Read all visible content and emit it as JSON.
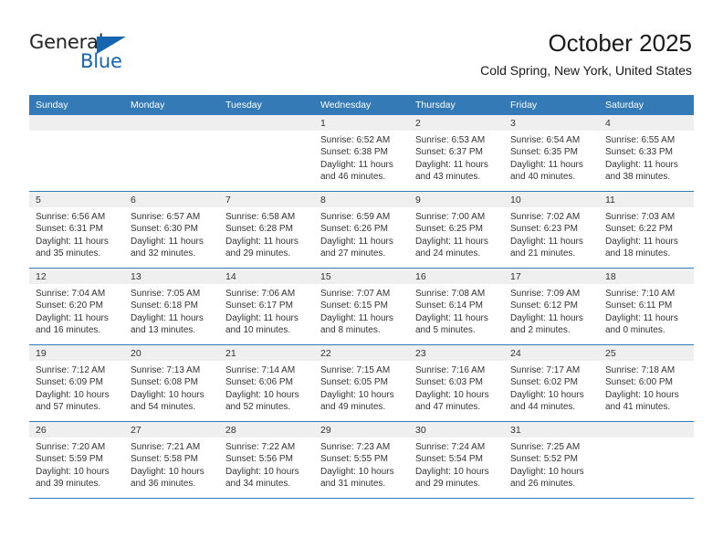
{
  "brand": {
    "name_part1": "General",
    "name_part2": "Blue",
    "accent_color": "#1565b0"
  },
  "header": {
    "title": "October 2025",
    "subtitle": "Cold Spring, New York, United States",
    "header_bg_color": "#337ab7",
    "daynum_band_color": "#efefef"
  },
  "weekday_headers": [
    "Sunday",
    "Monday",
    "Tuesday",
    "Wednesday",
    "Thursday",
    "Friday",
    "Saturday"
  ],
  "weeks": [
    [
      {
        "day": "",
        "sunrise": "",
        "sunset": "",
        "daylight_line1": "",
        "daylight_line2": ""
      },
      {
        "day": "",
        "sunrise": "",
        "sunset": "",
        "daylight_line1": "",
        "daylight_line2": ""
      },
      {
        "day": "",
        "sunrise": "",
        "sunset": "",
        "daylight_line1": "",
        "daylight_line2": ""
      },
      {
        "day": "1",
        "sunrise": "Sunrise: 6:52 AM",
        "sunset": "Sunset: 6:38 PM",
        "daylight_line1": "Daylight: 11 hours",
        "daylight_line2": "and 46 minutes."
      },
      {
        "day": "2",
        "sunrise": "Sunrise: 6:53 AM",
        "sunset": "Sunset: 6:37 PM",
        "daylight_line1": "Daylight: 11 hours",
        "daylight_line2": "and 43 minutes."
      },
      {
        "day": "3",
        "sunrise": "Sunrise: 6:54 AM",
        "sunset": "Sunset: 6:35 PM",
        "daylight_line1": "Daylight: 11 hours",
        "daylight_line2": "and 40 minutes."
      },
      {
        "day": "4",
        "sunrise": "Sunrise: 6:55 AM",
        "sunset": "Sunset: 6:33 PM",
        "daylight_line1": "Daylight: 11 hours",
        "daylight_line2": "and 38 minutes."
      }
    ],
    [
      {
        "day": "5",
        "sunrise": "Sunrise: 6:56 AM",
        "sunset": "Sunset: 6:31 PM",
        "daylight_line1": "Daylight: 11 hours",
        "daylight_line2": "and 35 minutes."
      },
      {
        "day": "6",
        "sunrise": "Sunrise: 6:57 AM",
        "sunset": "Sunset: 6:30 PM",
        "daylight_line1": "Daylight: 11 hours",
        "daylight_line2": "and 32 minutes."
      },
      {
        "day": "7",
        "sunrise": "Sunrise: 6:58 AM",
        "sunset": "Sunset: 6:28 PM",
        "daylight_line1": "Daylight: 11 hours",
        "daylight_line2": "and 29 minutes."
      },
      {
        "day": "8",
        "sunrise": "Sunrise: 6:59 AM",
        "sunset": "Sunset: 6:26 PM",
        "daylight_line1": "Daylight: 11 hours",
        "daylight_line2": "and 27 minutes."
      },
      {
        "day": "9",
        "sunrise": "Sunrise: 7:00 AM",
        "sunset": "Sunset: 6:25 PM",
        "daylight_line1": "Daylight: 11 hours",
        "daylight_line2": "and 24 minutes."
      },
      {
        "day": "10",
        "sunrise": "Sunrise: 7:02 AM",
        "sunset": "Sunset: 6:23 PM",
        "daylight_line1": "Daylight: 11 hours",
        "daylight_line2": "and 21 minutes."
      },
      {
        "day": "11",
        "sunrise": "Sunrise: 7:03 AM",
        "sunset": "Sunset: 6:22 PM",
        "daylight_line1": "Daylight: 11 hours",
        "daylight_line2": "and 18 minutes."
      }
    ],
    [
      {
        "day": "12",
        "sunrise": "Sunrise: 7:04 AM",
        "sunset": "Sunset: 6:20 PM",
        "daylight_line1": "Daylight: 11 hours",
        "daylight_line2": "and 16 minutes."
      },
      {
        "day": "13",
        "sunrise": "Sunrise: 7:05 AM",
        "sunset": "Sunset: 6:18 PM",
        "daylight_line1": "Daylight: 11 hours",
        "daylight_line2": "and 13 minutes."
      },
      {
        "day": "14",
        "sunrise": "Sunrise: 7:06 AM",
        "sunset": "Sunset: 6:17 PM",
        "daylight_line1": "Daylight: 11 hours",
        "daylight_line2": "and 10 minutes."
      },
      {
        "day": "15",
        "sunrise": "Sunrise: 7:07 AM",
        "sunset": "Sunset: 6:15 PM",
        "daylight_line1": "Daylight: 11 hours",
        "daylight_line2": "and 8 minutes."
      },
      {
        "day": "16",
        "sunrise": "Sunrise: 7:08 AM",
        "sunset": "Sunset: 6:14 PM",
        "daylight_line1": "Daylight: 11 hours",
        "daylight_line2": "and 5 minutes."
      },
      {
        "day": "17",
        "sunrise": "Sunrise: 7:09 AM",
        "sunset": "Sunset: 6:12 PM",
        "daylight_line1": "Daylight: 11 hours",
        "daylight_line2": "and 2 minutes."
      },
      {
        "day": "18",
        "sunrise": "Sunrise: 7:10 AM",
        "sunset": "Sunset: 6:11 PM",
        "daylight_line1": "Daylight: 11 hours",
        "daylight_line2": "and 0 minutes."
      }
    ],
    [
      {
        "day": "19",
        "sunrise": "Sunrise: 7:12 AM",
        "sunset": "Sunset: 6:09 PM",
        "daylight_line1": "Daylight: 10 hours",
        "daylight_line2": "and 57 minutes."
      },
      {
        "day": "20",
        "sunrise": "Sunrise: 7:13 AM",
        "sunset": "Sunset: 6:08 PM",
        "daylight_line1": "Daylight: 10 hours",
        "daylight_line2": "and 54 minutes."
      },
      {
        "day": "21",
        "sunrise": "Sunrise: 7:14 AM",
        "sunset": "Sunset: 6:06 PM",
        "daylight_line1": "Daylight: 10 hours",
        "daylight_line2": "and 52 minutes."
      },
      {
        "day": "22",
        "sunrise": "Sunrise: 7:15 AM",
        "sunset": "Sunset: 6:05 PM",
        "daylight_line1": "Daylight: 10 hours",
        "daylight_line2": "and 49 minutes."
      },
      {
        "day": "23",
        "sunrise": "Sunrise: 7:16 AM",
        "sunset": "Sunset: 6:03 PM",
        "daylight_line1": "Daylight: 10 hours",
        "daylight_line2": "and 47 minutes."
      },
      {
        "day": "24",
        "sunrise": "Sunrise: 7:17 AM",
        "sunset": "Sunset: 6:02 PM",
        "daylight_line1": "Daylight: 10 hours",
        "daylight_line2": "and 44 minutes."
      },
      {
        "day": "25",
        "sunrise": "Sunrise: 7:18 AM",
        "sunset": "Sunset: 6:00 PM",
        "daylight_line1": "Daylight: 10 hours",
        "daylight_line2": "and 41 minutes."
      }
    ],
    [
      {
        "day": "26",
        "sunrise": "Sunrise: 7:20 AM",
        "sunset": "Sunset: 5:59 PM",
        "daylight_line1": "Daylight: 10 hours",
        "daylight_line2": "and 39 minutes."
      },
      {
        "day": "27",
        "sunrise": "Sunrise: 7:21 AM",
        "sunset": "Sunset: 5:58 PM",
        "daylight_line1": "Daylight: 10 hours",
        "daylight_line2": "and 36 minutes."
      },
      {
        "day": "28",
        "sunrise": "Sunrise: 7:22 AM",
        "sunset": "Sunset: 5:56 PM",
        "daylight_line1": "Daylight: 10 hours",
        "daylight_line2": "and 34 minutes."
      },
      {
        "day": "29",
        "sunrise": "Sunrise: 7:23 AM",
        "sunset": "Sunset: 5:55 PM",
        "daylight_line1": "Daylight: 10 hours",
        "daylight_line2": "and 31 minutes."
      },
      {
        "day": "30",
        "sunrise": "Sunrise: 7:24 AM",
        "sunset": "Sunset: 5:54 PM",
        "daylight_line1": "Daylight: 10 hours",
        "daylight_line2": "and 29 minutes."
      },
      {
        "day": "31",
        "sunrise": "Sunrise: 7:25 AM",
        "sunset": "Sunset: 5:52 PM",
        "daylight_line1": "Daylight: 10 hours",
        "daylight_line2": "and 26 minutes."
      },
      {
        "day": "",
        "sunrise": "",
        "sunset": "",
        "daylight_line1": "",
        "daylight_line2": ""
      }
    ]
  ]
}
